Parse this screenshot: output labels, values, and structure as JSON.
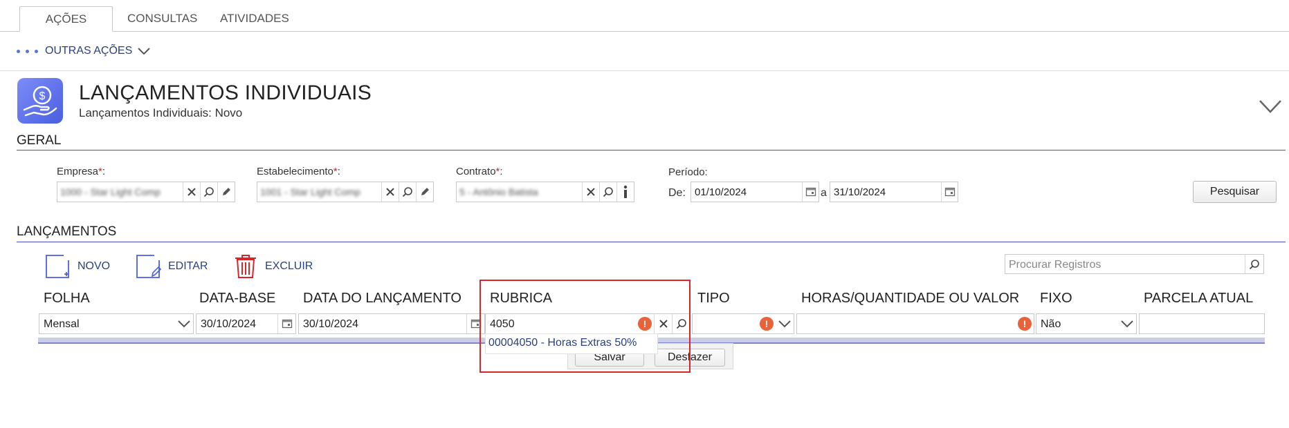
{
  "tabs": [
    {
      "label": "AÇÕES",
      "active": true
    },
    {
      "label": "CONSULTAS",
      "active": false
    },
    {
      "label": "ATIVIDADES",
      "active": false
    }
  ],
  "other_actions": {
    "label": "OUTRAS AÇÕES"
  },
  "header": {
    "icon": "money-hand-icon",
    "title": "LANÇAMENTOS INDIVIDUAIS",
    "subtitle": "Lançamentos Individuais: Novo"
  },
  "geral": {
    "title": "GERAL",
    "empresa": {
      "label": "Empresa",
      "required_mark": "*",
      "suffix": ":",
      "value": "1000 - Star Light Comp"
    },
    "estabelecimento": {
      "label": "Estabelecimento",
      "required_mark": "*",
      "suffix": ":",
      "value": "1001 - Star Light Comp"
    },
    "contrato": {
      "label": "Contrato",
      "required_mark": "*",
      "suffix": ":",
      "value": "5 - Antônio Batista"
    },
    "periodo": {
      "label": "Período:",
      "de_label": "De:",
      "de_value": "01/10/2024",
      "a_label": "a",
      "a_value": "31/10/2024"
    },
    "search_button": "Pesquisar"
  },
  "lancamentos": {
    "title": "LANÇAMENTOS",
    "toolbar": {
      "novo": "NOVO",
      "editar": "EDITAR",
      "excluir": "EXCLUIR"
    },
    "search_placeholder": "Procurar Registros",
    "columns": {
      "folha": "FOLHA",
      "data_base": "DATA-BASE",
      "data_lancamento": "DATA DO LANÇAMENTO",
      "rubrica": "RUBRICA",
      "tipo": "TIPO",
      "horas": "HORAS/QUANTIDADE OU VALOR",
      "fixo": "FIXO",
      "parcela": "PARCELA ATUAL"
    },
    "row": {
      "folha": "Mensal",
      "data_base": "30/10/2024",
      "data_lancamento": "30/10/2024",
      "rubrica": "4050",
      "tipo": "",
      "horas": "",
      "fixo": "Não",
      "parcela": ""
    },
    "row_buttons": {
      "save": "Salvar",
      "undo": "Desfazer"
    },
    "rubrica_suggestions": [
      "00004050 - Horas Extras 50%"
    ]
  },
  "colors": {
    "accent": "#4a4ad0",
    "link": "#2a3f80",
    "error": "#e8623a",
    "highlight": "#d9242a",
    "delete": "#d9242a"
  }
}
